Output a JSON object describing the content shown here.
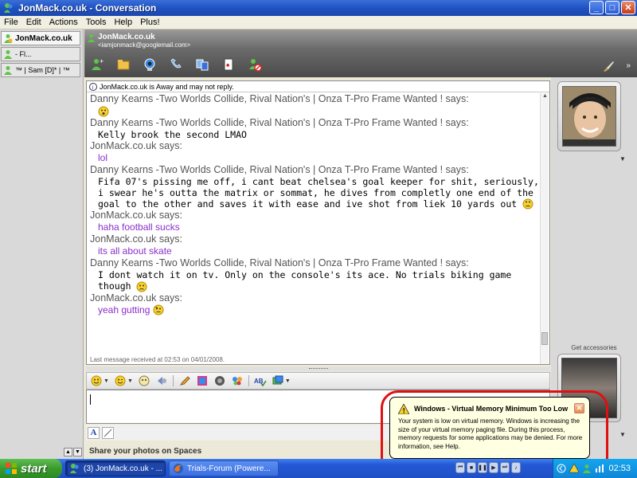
{
  "window": {
    "title": "JonMack.co.uk - Conversation",
    "minimize": "_",
    "maximize": "□",
    "close": "✕"
  },
  "menu": [
    "File",
    "Edit",
    "Actions",
    "Tools",
    "Help",
    "Plus!"
  ],
  "contact_tabs": [
    {
      "label": "JonMack.co.uk"
    },
    {
      "label": "-                    Fl..."
    },
    {
      "label": "™ | Sam [D]* | ™"
    }
  ],
  "header": {
    "contact_name": "JonMack.co.uk",
    "contact_email": "<iamjonmack@googlemail.com>"
  },
  "chat": {
    "status_info": "JonMack.co.uk is Away and may not reply.",
    "messages": [
      {
        "sender": "Danny Kearns -Two Worlds Collide, Rival Nation's | Onza T-Pro Frame Wanted ! says:",
        "type": "danny",
        "text": "",
        "emoticon": "surprised"
      },
      {
        "sender": "Danny Kearns -Two Worlds Collide, Rival Nation's | Onza T-Pro Frame Wanted ! says:",
        "type": "danny",
        "text": "Kelly brook the second LMAO",
        "emoticon": ""
      },
      {
        "sender": "JonMack.co.uk says:",
        "type": "jon",
        "text": "lol",
        "emoticon": ""
      },
      {
        "sender": "Danny Kearns -Two Worlds Collide, Rival Nation's | Onza T-Pro Frame Wanted ! says:",
        "type": "danny",
        "text": "Fifa 07's pissing me off, i cant beat chelsea's goal keeper for shit, seriously, i swear he's outta the matrix or sommat, he dives from completly one end of the goal to the other and saves it with ease and ive shot from liek 10 yards out",
        "emoticon": "eyeroll"
      },
      {
        "sender": "JonMack.co.uk says:",
        "type": "jon",
        "text": "haha football sucks",
        "emoticon": ""
      },
      {
        "sender": "JonMack.co.uk says:",
        "type": "jon",
        "text": "its all about skate",
        "emoticon": ""
      },
      {
        "sender": "Danny Kearns -Two Worlds Collide, Rival Nation's | Onza T-Pro Frame Wanted ! says:",
        "type": "danny",
        "text": "I dont watch it on tv. Only on the console's its ace. No trials biking game though",
        "emoticon": "sad"
      },
      {
        "sender": "JonMack.co.uk says:",
        "type": "jon",
        "text": "yeah gutting",
        "emoticon": "worried"
      }
    ],
    "last_received": "Last message received at 02:53 on 04/01/2008."
  },
  "right_pane": {
    "get_accessories": "Get accessories"
  },
  "share": {
    "label": "Share your photos on Spaces"
  },
  "balloon": {
    "title": "Windows - Virtual Memory Minimum Too Low",
    "body": "Your system is low on virtual memory. Windows is increasing the size of your virtual memory paging file. During this process, memory requests for some applications may be denied. For more information, see Help.",
    "close": "✕"
  },
  "taskbar": {
    "start": "start",
    "tasks": [
      {
        "label": "(3) JonMack.co.uk - ..."
      },
      {
        "label": "Trials-Forum (Powere..."
      }
    ],
    "clock": "02:53"
  },
  "colors": {
    "xp_blue": "#2052c2",
    "jon_text": "#8b2fc9",
    "balloon_bg": "#ffffe1",
    "highlight_red": "#e01010",
    "start_green": "#3a9a2e"
  }
}
